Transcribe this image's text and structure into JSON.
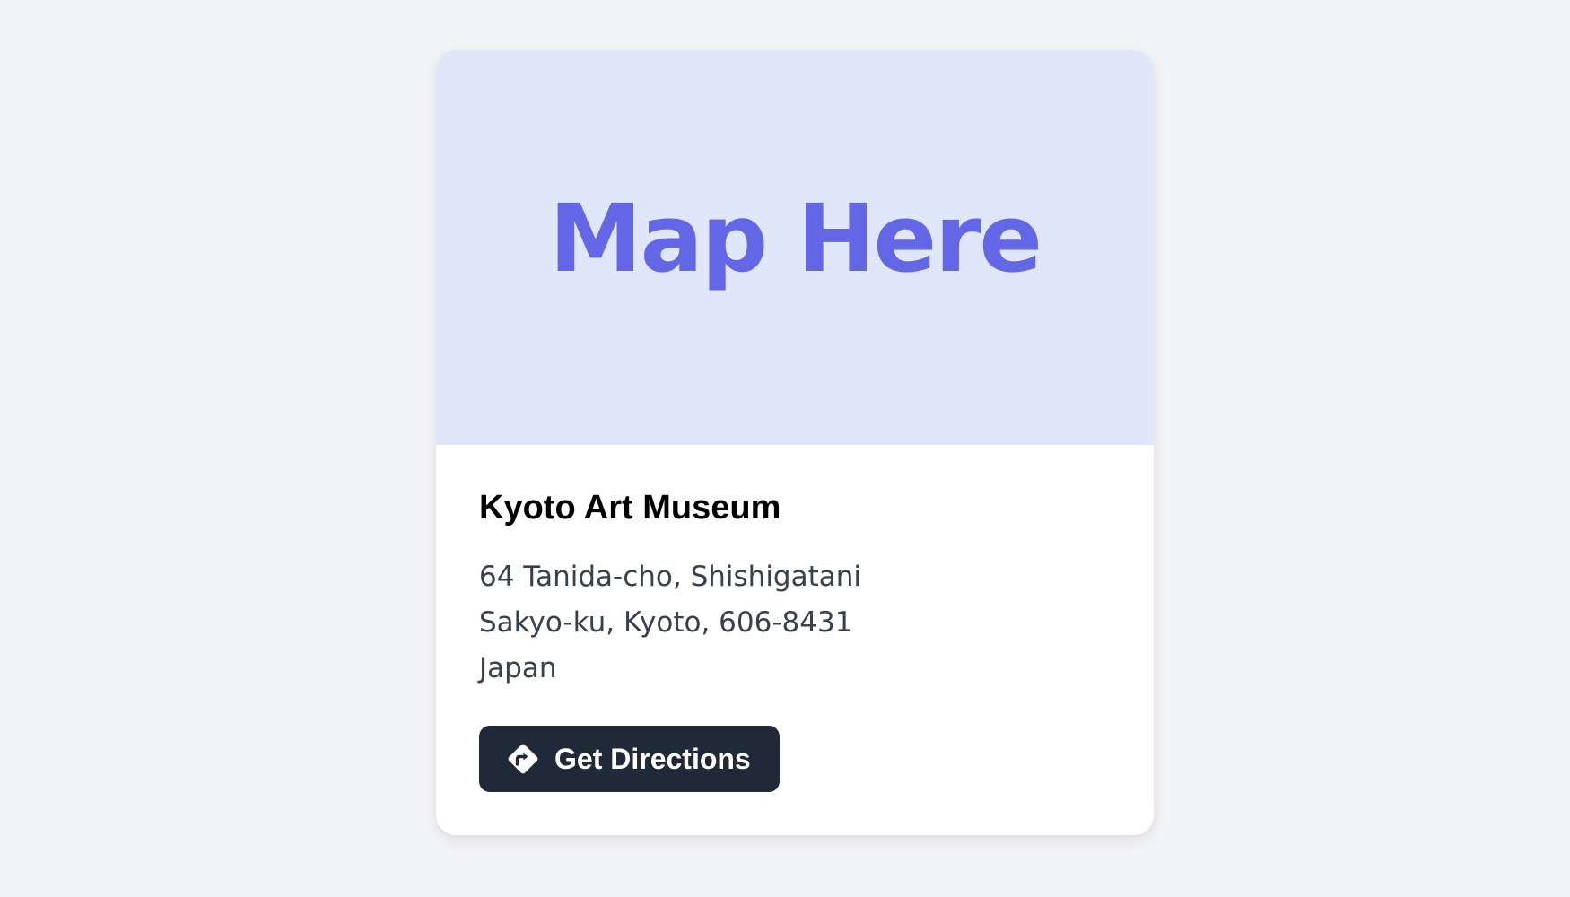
{
  "map": {
    "placeholder_text": "Map Here",
    "background_color": "#e0e7fb",
    "text_color": "#6366e5"
  },
  "location": {
    "name": "Kyoto Art Museum",
    "address_lines": [
      "64 Tanida-cho, Shishigatani",
      "Sakyo-ku, Kyoto, 606-8431",
      "Japan"
    ]
  },
  "actions": {
    "directions_label": "Get Directions",
    "directions_icon": "directions-sign-icon",
    "button_color": "#1f2937"
  },
  "colors": {
    "page_background": "#f3f4f6",
    "card_background": "#ffffff",
    "address_text": "#374151"
  }
}
